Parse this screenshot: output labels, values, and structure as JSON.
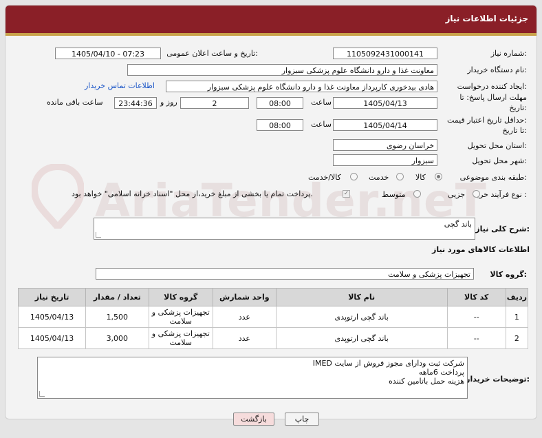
{
  "header": {
    "title": "جزئیات اطلاعات نیاز"
  },
  "fields": {
    "need_number_label": "شماره نیاز:",
    "need_number": "1105092431000141",
    "announce_label": "تاریخ و ساعت اعلان عمومی:",
    "announce_value": "1405/04/10 - 07:23",
    "buyer_org_label": "نام دستگاه خریدار:",
    "buyer_org": "معاونت غذا و دارو   دانشگاه علوم پزشکی سبزوار",
    "creator_label": "ایجاد کننده درخواست:",
    "creator": "هادی بیدخوری کارپرداز معاونت غذا و دارو   دانشگاه علوم پزشکی سبزوار",
    "contact_link": "اطلاعات تماس خریدار",
    "reply_deadline_label_1": "مهلت ارسال پاسخ: تا",
    "reply_deadline_label_2": "تاریخ:",
    "reply_date": "1405/04/13",
    "time_label": "ساعت",
    "reply_time": "08:00",
    "days_value": "2",
    "days_label": "روز و",
    "remaining_time": "23:44:36",
    "remaining_label": "ساعت باقی مانده",
    "price_deadline_label_1": "حداقل تاریخ اعتبار قیمت:",
    "price_deadline_label_2": "تا تاریخ:",
    "price_date": "1405/04/14",
    "price_time": "08:00",
    "province_label": "استان محل تحویل:",
    "province": "خراسان رضوی",
    "city_label": "شهر محل تحویل:",
    "city": "سبزوار",
    "category_label": "طبقه بندی موضوعی:",
    "category_options": [
      "کالا",
      "خدمت",
      "کالا/خدمت"
    ],
    "purchase_type_label": "نوع فرآیند خرید :",
    "purchase_options": [
      "جزیی",
      "متوسط"
    ],
    "payment_note": "پرداخت تمام یا بخشی از مبلغ خرید،از محل \"اسناد خزانه اسلامی\" خواهد بود."
  },
  "description": {
    "label": "شرح کلی نیاز:",
    "value": "باند گچی"
  },
  "goods_section_title": "اطلاعات کالاهای مورد نیاز",
  "goods_group": {
    "label": "گروه کالا:",
    "value": "تجهیزات پزشکی و سلامت"
  },
  "table": {
    "headers": [
      "ردیف",
      "کد کالا",
      "نام کالا",
      "واحد شمارش",
      "گروه کالا",
      "تعداد / مقدار",
      "تاریخ نیاز"
    ],
    "rows": [
      [
        "1",
        "--",
        "باند گچی ارتوپدی",
        "عدد",
        "تجهیزات پزشکی و سلامت",
        "1,500",
        "1405/04/13"
      ],
      [
        "2",
        "--",
        "باند گچی ارتوپدی",
        "عدد",
        "تجهیزات پزشکی و سلامت",
        "3,000",
        "1405/04/13"
      ]
    ]
  },
  "buyer_notes": {
    "label": "توضیحات خریدار:",
    "lines": [
      "شرکت ثبت ودارای مجوز فروش از سایت IMED",
      "پرداخت 6ماهه",
      "هزینه حمل باتامین کننده"
    ]
  },
  "buttons": {
    "print": "چاپ",
    "back": "بازگشت"
  },
  "watermark": "AriaTender.neT",
  "colors": {
    "header_bg": "#8a1f27",
    "header_border": "#c9a34a",
    "link": "#1a55c7",
    "back_button_bg": "#f6dcdc"
  }
}
